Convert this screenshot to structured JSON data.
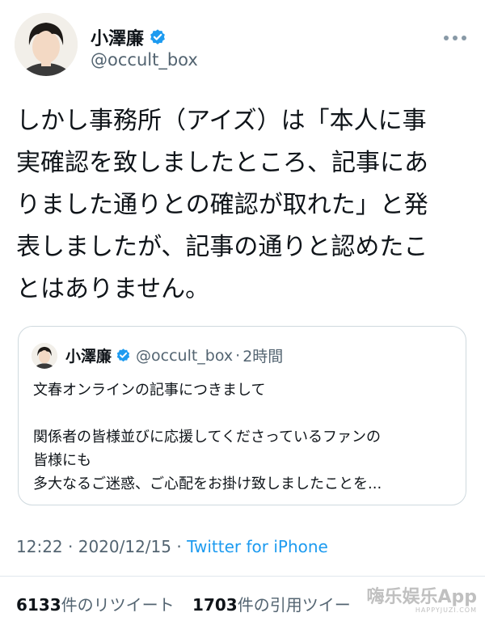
{
  "author": {
    "name": "小澤廉",
    "handle": "@occult_box",
    "avatar_icon": "user-avatar-photo",
    "verified_icon": "verified-badge-icon",
    "more_icon": "more-options-icon"
  },
  "tweet": {
    "text": "しかし事務所（アイズ）は「本人に事\n実確認を致しましたところ、記事にあ\nりました通りとの確認が取れた」と発\n表しましたが、記事の通りと認めたこ\nとはありません。"
  },
  "quote_tweet": {
    "name": "小澤廉",
    "handle": "@occult_box",
    "separator": "·",
    "time": "2時間",
    "body": "文春オンラインの記事につきまして\n\n関係者の皆様並びに応援してくださっているファンの\n皆様にも\n多大なるご迷惑、ご心配をお掛け致しましたことを..."
  },
  "meta": {
    "time": "12:22",
    "date": "2020/12/15",
    "separator": " · ",
    "source": "Twitter for iPhone"
  },
  "stats": {
    "retweets_count": "6133",
    "retweets_label": "件のリツイート",
    "quotes_count": "1703",
    "quotes_label": "件の引用ツイー"
  },
  "watermark": {
    "text": "嗨乐娱乐App",
    "subtext": "HAPPYJUZI.COM"
  },
  "colors": {
    "accent": "#1d9bf0",
    "text": "#0f1419",
    "secondary": "#536471",
    "border": "#cfd9de"
  }
}
